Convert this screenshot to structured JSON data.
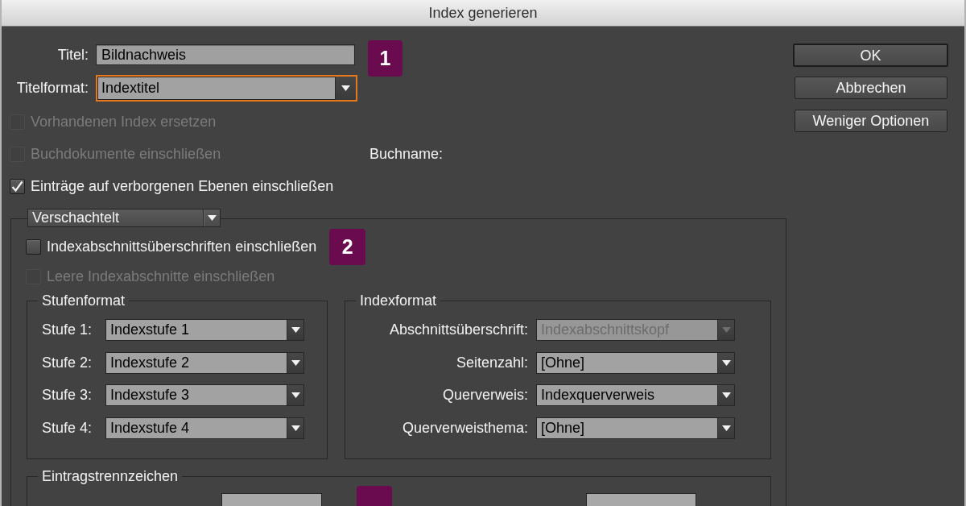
{
  "window": {
    "title": "Index generieren"
  },
  "title_field": {
    "label": "Titel:",
    "value": "Bildnachweis",
    "badge": "1"
  },
  "title_format": {
    "label": "Titelformat:",
    "value": "Indextitel",
    "focused": true
  },
  "options": [
    {
      "label": "Vorhandenen Index ersetzen",
      "checked": false,
      "disabled": true
    },
    {
      "label": "Buchdokumente einschließen",
      "checked": false,
      "disabled": true,
      "side_label": "Buchname:"
    },
    {
      "label": "Einträge auf verborgenen Ebenen einschließen",
      "checked": true,
      "disabled": false
    }
  ],
  "buttons": [
    {
      "label": "OK",
      "default": true
    },
    {
      "label": "Abbrechen",
      "default": false
    },
    {
      "label": "Weniger Optionen",
      "default": false
    }
  ],
  "index_type": {
    "value": "Verschachtelt",
    "options": [
      {
        "label": "Indexabschnittsüberschriften einschließen",
        "checked": false,
        "disabled": false,
        "badge": "2"
      },
      {
        "label": "Leere Indexabschnitte einschließen",
        "checked": false,
        "disabled": true
      }
    ],
    "level_format": {
      "legend": "Stufenformat",
      "rows": [
        {
          "label": "Stufe 1:",
          "value": "Indexstufe 1",
          "disabled": false
        },
        {
          "label": "Stufe 2:",
          "value": "Indexstufe 2",
          "disabled": false
        },
        {
          "label": "Stufe 3:",
          "value": "Indexstufe 3",
          "disabled": false
        },
        {
          "label": "Stufe 4:",
          "value": "Indexstufe 4",
          "disabled": false
        }
      ]
    },
    "index_format": {
      "legend": "Indexformat",
      "rows": [
        {
          "label": "Abschnittsüberschrift:",
          "value": "Indexabschnittskopf",
          "disabled": true
        },
        {
          "label": "Seitenzahl:",
          "value": "[Ohne]",
          "disabled": false
        },
        {
          "label": "Querverweis:",
          "value": "Indexquerverweis",
          "disabled": false
        },
        {
          "label": "Querverweisthema:",
          "value": "[Ohne]",
          "disabled": false
        }
      ]
    },
    "entry_separators": {
      "legend": "Eintragstrennzeichen",
      "partial_items": [
        {
          "kind": "field"
        },
        {
          "kind": "badge"
        },
        {
          "kind": "field"
        }
      ]
    }
  }
}
